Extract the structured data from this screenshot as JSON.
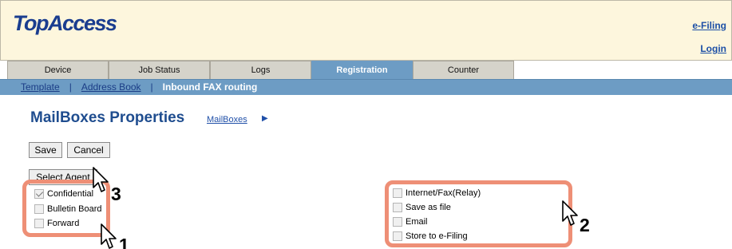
{
  "header": {
    "logo_text": "TopAccess",
    "links": {
      "efiling": "e-Filing",
      "login": "Login"
    }
  },
  "tabs": [
    {
      "label": "Device",
      "active": false
    },
    {
      "label": "Job Status",
      "active": false
    },
    {
      "label": "Logs",
      "active": false
    },
    {
      "label": "Registration",
      "active": true
    },
    {
      "label": "Counter",
      "active": false
    }
  ],
  "subnav": {
    "items": [
      {
        "label": "Template",
        "link": true
      },
      {
        "label": "Address Book",
        "link": true
      },
      {
        "label": "Inbound FAX routing",
        "link": false
      }
    ],
    "separator": "|"
  },
  "page": {
    "title": "MailBoxes Properties",
    "breadcrumb": "MailBoxes",
    "breadcrumb_arrow": "▶"
  },
  "buttons": {
    "save": "Save",
    "cancel": "Cancel",
    "select_agent": "Select Agent"
  },
  "agents_left": [
    {
      "label": "Confidential",
      "checked": true
    },
    {
      "label": "Bulletin Board",
      "checked": false
    },
    {
      "label": "Forward",
      "checked": false
    }
  ],
  "agents_right": [
    {
      "label": "Internet/Fax(Relay)",
      "checked": false
    },
    {
      "label": "Save as file",
      "checked": false
    },
    {
      "label": "Email",
      "checked": false
    },
    {
      "label": "Store to e-Filing",
      "checked": false
    }
  ],
  "annotations": {
    "step1": "1",
    "step2": "2",
    "step3": "3"
  },
  "colors": {
    "callout": "#ee8f76",
    "accent_blue": "#6d9cc4",
    "header_bg": "#fdf6dd",
    "title_blue": "#1f4d8f"
  }
}
